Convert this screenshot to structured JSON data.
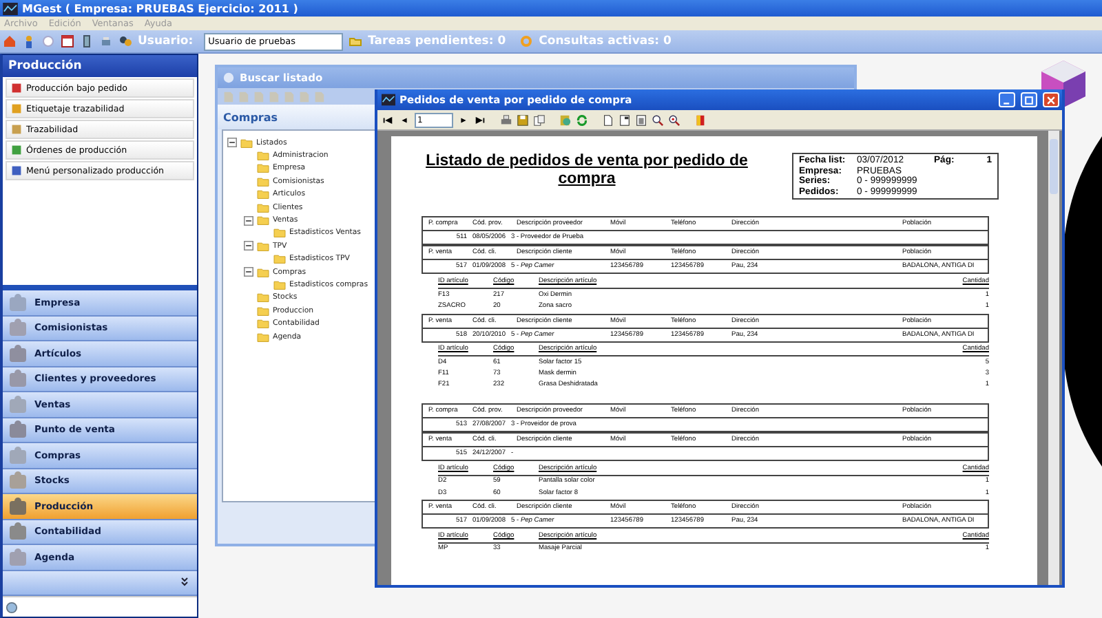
{
  "window": {
    "title": "MGest ( Empresa: PRUEBAS Ejercicio: 2011 )"
  },
  "menu": [
    "Archivo",
    "Edición",
    "Ventanas",
    "Ayuda"
  ],
  "toolbar": {
    "user_label": "Usuario:",
    "user_value": "Usuario de pruebas",
    "tasks": "Tareas pendientes: 0",
    "queries": "Consultas activas: 0"
  },
  "sidebar": {
    "title": "Producción",
    "items": [
      "Producción bajo pedido",
      "Etiquetaje trazabilidad",
      "Trazabilidad",
      "Órdenes de producción",
      "Menú personalizado producción"
    ],
    "nav": [
      {
        "label": "Empresa",
        "selected": false
      },
      {
        "label": "Comisionistas",
        "selected": false
      },
      {
        "label": "Artículos",
        "selected": false
      },
      {
        "label": "Clientes y proveedores",
        "selected": false
      },
      {
        "label": "Ventas",
        "selected": false
      },
      {
        "label": "Punto de venta",
        "selected": false
      },
      {
        "label": "Compras",
        "selected": false
      },
      {
        "label": "Stocks",
        "selected": false
      },
      {
        "label": "Producción",
        "selected": true
      },
      {
        "label": "Contabilidad",
        "selected": false
      },
      {
        "label": "Agenda",
        "selected": false
      }
    ]
  },
  "search_window": {
    "title": "Buscar listado",
    "section": "Compras",
    "tree": [
      {
        "label": "Listados",
        "expanded": true,
        "children": [
          {
            "label": "Administracion"
          },
          {
            "label": "Empresa"
          },
          {
            "label": "Comisionistas"
          },
          {
            "label": "Articulos"
          },
          {
            "label": "Clientes"
          },
          {
            "label": "Ventas",
            "expanded": true,
            "children": [
              {
                "label": "Estadisticos Ventas"
              }
            ]
          },
          {
            "label": "TPV",
            "expanded": true,
            "children": [
              {
                "label": "Estadisticos TPV"
              }
            ]
          },
          {
            "label": "Compras",
            "expanded": true,
            "children": [
              {
                "label": "Estadisticos compras"
              }
            ]
          },
          {
            "label": "Stocks"
          },
          {
            "label": "Produccion"
          },
          {
            "label": "Contabilidad"
          },
          {
            "label": "Agenda"
          }
        ]
      }
    ]
  },
  "report_window": {
    "title": "Pedidos de venta por pedido de compra",
    "page": "1",
    "report_title": "Listado de pedidos de venta por pedido de compra",
    "info": [
      {
        "label": "Fecha list:",
        "value": "03/07/2012"
      },
      {
        "label": "Empresa:",
        "value": "PRUEBAS"
      },
      {
        "label": "Series:",
        "value": "0 - 999999999"
      },
      {
        "label": "Pedidos:",
        "value": "0 - 999999999"
      }
    ],
    "page_label": "Pág:",
    "page_number": "1",
    "orders": [
      {
        "blocks": [
          {
            "kind": "header",
            "cells": [
              "P. compra",
              "Cód. prov.",
              "Descripción proveedor",
              "Móvil",
              "Teléfono",
              "Dirección",
              "Población"
            ]
          },
          {
            "kind": "row",
            "cells": {
              "num": "511",
              "date": "08/05/2006",
              "name": "3 -   Proveedor de Prueba"
            }
          },
          {
            "kind": "header",
            "cells": [
              "P. venta",
              "Cód. cli.",
              "Descripción cliente",
              "Móvil",
              "Teléfono",
              "Dirección",
              "Población"
            ]
          },
          {
            "kind": "row",
            "cells": {
              "num": "517",
              "date": "01/09/2008",
              "name": "5 - *Pep Camer*",
              "mobile": "123456789",
              "phone": "123456789",
              "address": "Pau, 234",
              "city": "BADALONA, ANTIGA DI"
            }
          },
          {
            "kind": "items",
            "header": [
              "ID artículo",
              "Código",
              "Descripción artículo",
              "Cantidad"
            ],
            "rows": [
              [
                "F13",
                "217",
                "Oxi Dermin",
                "1"
              ],
              [
                "ZSACRO",
                "20",
                "Zona sacro",
                "1"
              ]
            ]
          },
          {
            "kind": "header",
            "cells": [
              "P. venta",
              "Cód. cli.",
              "Descripción cliente",
              "Móvil",
              "Teléfono",
              "Dirección",
              "Población"
            ]
          },
          {
            "kind": "row",
            "cells": {
              "num": "518",
              "date": "20/10/2010",
              "name": "5 - *Pep Camer*",
              "mobile": "123456789",
              "phone": "123456789",
              "address": "Pau, 234",
              "city": "BADALONA, ANTIGA DI"
            }
          },
          {
            "kind": "items",
            "header": [
              "ID artículo",
              "Código",
              "Descripción artículo",
              "Cantidad"
            ],
            "rows": [
              [
                "D4",
                "61",
                "Solar factor 15",
                "5"
              ],
              [
                "F11",
                "73",
                "Mask dermin",
                "3"
              ],
              [
                "F21",
                "232",
                "Grasa Deshidratada",
                "1"
              ]
            ]
          }
        ]
      },
      {
        "blocks": [
          {
            "kind": "header",
            "cells": [
              "P. compra",
              "Cód. prov.",
              "Descripción proveedor",
              "Móvil",
              "Teléfono",
              "Dirección",
              "Población"
            ]
          },
          {
            "kind": "row",
            "cells": {
              "num": "513",
              "date": "27/08/2007",
              "name": "3 - Proveidor de prova"
            }
          },
          {
            "kind": "header",
            "cells": [
              "P. venta",
              "Cód. cli.",
              "Descripción cliente",
              "Móvil",
              "Teléfono",
              "Dirección",
              "Población"
            ]
          },
          {
            "kind": "row",
            "cells": {
              "num": "515",
              "date": "24/12/2007",
              "name": "-"
            }
          },
          {
            "kind": "items",
            "header": [
              "ID artículo",
              "Código",
              "Descripción artículo",
              "Cantidad"
            ],
            "rows": [
              [
                "D2",
                "59",
                "Pantalla solar color",
                "1"
              ],
              [
                "D3",
                "60",
                "Solar factor 8",
                "1"
              ]
            ]
          },
          {
            "kind": "header",
            "cells": [
              "P. venta",
              "Cód. cli.",
              "Descripción cliente",
              "Móvil",
              "Teléfono",
              "Dirección",
              "Población"
            ]
          },
          {
            "kind": "row",
            "cells": {
              "num": "517",
              "date": "01/09/2008",
              "name": "5 - *Pep Camer*",
              "mobile": "123456789",
              "phone": "123456789",
              "address": "Pau, 234",
              "city": "BADALONA, ANTIGA DI"
            }
          },
          {
            "kind": "items",
            "header": [
              "ID artículo",
              "Código",
              "Descripción artículo",
              "Cantidad"
            ],
            "rows": [
              [
                "MP",
                "33",
                "Masaje Parcial",
                "1"
              ]
            ]
          }
        ]
      }
    ]
  }
}
